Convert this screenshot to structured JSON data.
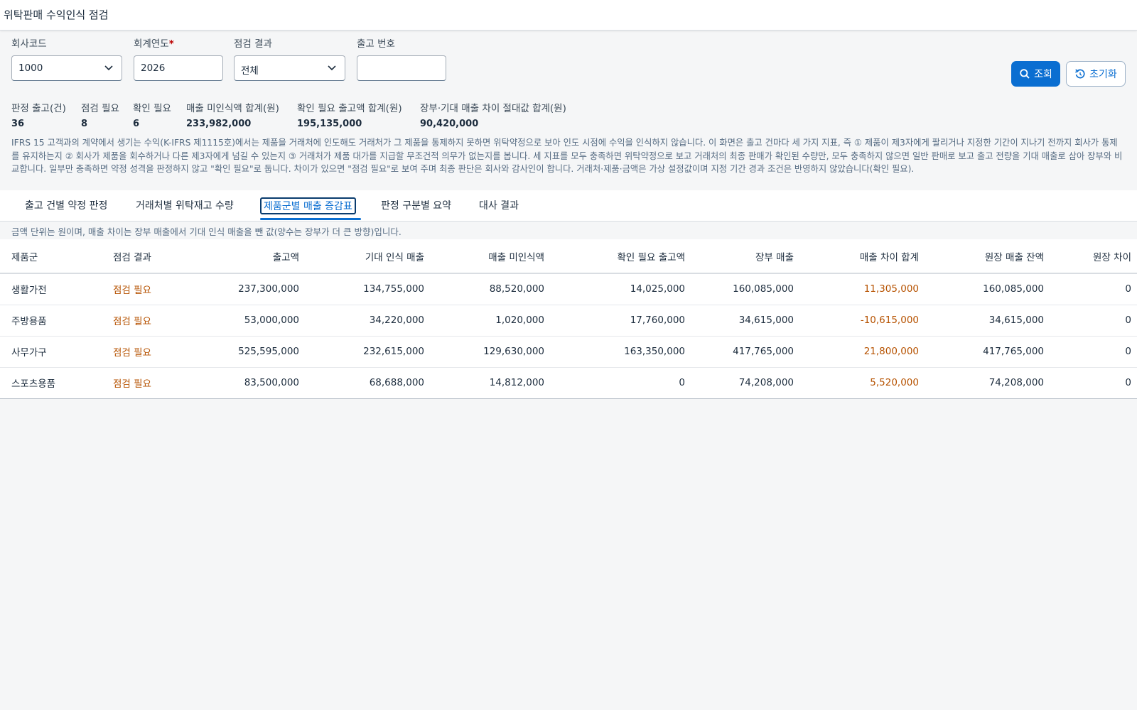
{
  "app": {
    "title": "위탁판매 수익인식 점검"
  },
  "filters": {
    "company_code": {
      "label": "회사코드",
      "value": "1000",
      "icon": "chevron-down-icon"
    },
    "fiscal_year": {
      "label": "회계연도",
      "required_mark": "*",
      "value": "2026"
    },
    "check_result": {
      "label": "점검 결과",
      "value": "전체",
      "icon": "chevron-down-icon"
    },
    "delivery_no": {
      "label": "출고 번호",
      "value": ""
    }
  },
  "actions": {
    "search": {
      "label": "조회",
      "icon": "search-icon"
    },
    "reset": {
      "label": "초기화",
      "icon": "reset-icon"
    }
  },
  "kpis": [
    {
      "label": "판정 출고(건)",
      "value": "36"
    },
    {
      "label": "점검 필요",
      "value": "8"
    },
    {
      "label": "확인 필요",
      "value": "6"
    },
    {
      "label": "매출 미인식액 합계(원)",
      "value": "233,982,000"
    },
    {
      "label": "확인 필요 출고액 합계(원)",
      "value": "195,135,000"
    },
    {
      "label": "장부·기대 매출 차이 절대값 합계(원)",
      "value": "90,420,000"
    }
  ],
  "description": "IFRS 15 고객과의 계약에서 생기는 수익(K-IFRS 제1115호)에서는 제품을 거래처에 인도해도 거래처가 그 제품을 통제하지 못하면 위탁약정으로 보아 인도 시점에 수익을 인식하지 않습니다. 이 화면은 출고 건마다 세 가지 지표, 즉 ① 제품이 제3자에게 팔리거나 지정한 기간이 지나기 전까지 회사가 통제를 유지하는지 ② 회사가 제품을 회수하거나 다른 제3자에게 넘길 수 있는지 ③ 거래처가 제품 대가를 지급할 무조건적 의무가 없는지를 봅니다. 세 지표를 모두 충족하면 위탁약정으로 보고 거래처의 최종 판매가 확인된 수량만, 모두 충족하지 않으면 일반 판매로 보고 출고 전량을 기대 매출로 삼아 장부와 비교합니다. 일부만 충족하면 약정 성격을 판정하지 않고 \"확인 필요\"로 둡니다. 차이가 있으면 \"점검 필요\"로 보여 주며 최종 판단은 회사와 감사인이 합니다. 거래처·제품·금액은 가상 설정값이며 지정 기간 경과 조건은 반영하지 않았습니다(확인 필요).",
  "tabs": [
    {
      "label": "출고 건별 약정 판정",
      "active": false
    },
    {
      "label": "거래처별 위탁재고 수량",
      "active": false
    },
    {
      "label": "제품군별 매출 증감표",
      "active": true
    },
    {
      "label": "판정 구분별 요약",
      "active": false
    },
    {
      "label": "대사 결과",
      "active": false
    }
  ],
  "note": "금액 단위는 원이며, 매출 차이는 장부 매출에서 기대 인식 매출을 뺀 값(양수는 장부가 더 큰 방향)입니다.",
  "table": {
    "columns": [
      "제품군",
      "점검 결과",
      "출고액",
      "기대 인식 매출",
      "매출 미인식액",
      "확인 필요 출고액",
      "장부 매출",
      "매출 차이 합계",
      "원장 매출 잔액",
      "원장 차이"
    ],
    "rows": [
      [
        "생활가전",
        "점검 필요",
        "237,300,000",
        "134,755,000",
        "88,520,000",
        "14,025,000",
        "160,085,000",
        "11,305,000",
        "160,085,000",
        "0"
      ],
      [
        "주방용품",
        "점검 필요",
        "53,000,000",
        "34,220,000",
        "1,020,000",
        "17,760,000",
        "34,615,000",
        "-10,615,000",
        "34,615,000",
        "0"
      ],
      [
        "사무가구",
        "점검 필요",
        "525,595,000",
        "232,615,000",
        "129,630,000",
        "163,350,000",
        "417,765,000",
        "21,800,000",
        "417,765,000",
        "0"
      ],
      [
        "스포츠용품",
        "점검 필요",
        "83,500,000",
        "68,688,000",
        "14,812,000",
        "0",
        "74,208,000",
        "5,520,000",
        "74,208,000",
        "0"
      ]
    ]
  },
  "colors": {
    "accent": "#0a6ed1",
    "warning": "#b65200",
    "required": "#bb0000"
  }
}
